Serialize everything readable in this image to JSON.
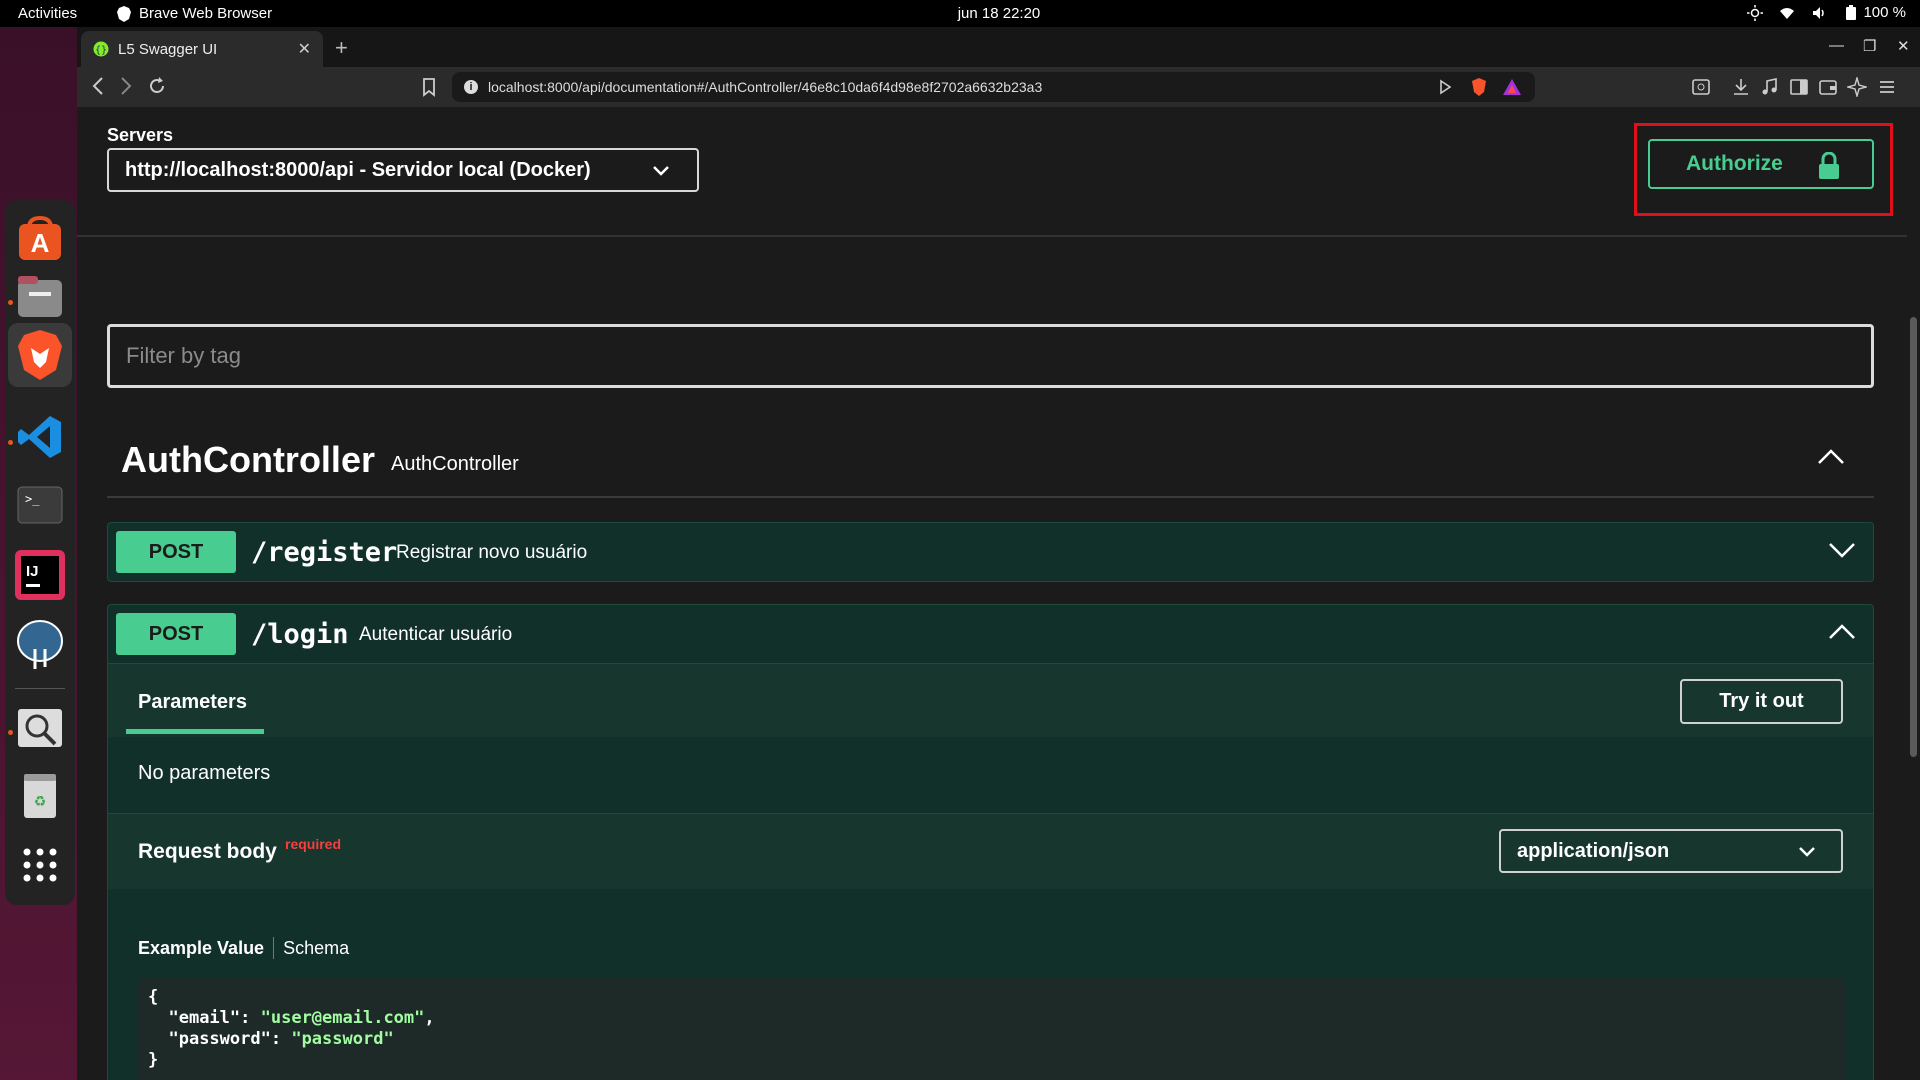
{
  "system": {
    "activities": "Activities",
    "app_name": "Brave Web Browser",
    "clock": "jun 18  22:20",
    "battery": "100 %"
  },
  "browser": {
    "tab_title": "L5 Swagger UI",
    "new_tab": "+",
    "url": "localhost:8000/api/documentation#/AuthController/46e8c10da6f4d98e8f2702a6632b23a3"
  },
  "swagger": {
    "servers_label": "Servers",
    "server_selected": "http://localhost:8000/api - Servidor local (Docker)",
    "authorize_label": "Authorize",
    "filter_placeholder": "Filter by tag",
    "tag": {
      "name": "AuthController",
      "description": "AuthController"
    },
    "operations": [
      {
        "method": "POST",
        "path": "/register",
        "summary": "Registrar novo usuário",
        "expanded": false
      },
      {
        "method": "POST",
        "path": "/login",
        "summary": "Autenticar usuário",
        "expanded": true
      }
    ],
    "login_detail": {
      "parameters_tab": "Parameters",
      "try_it_out": "Try it out",
      "no_parameters": "No parameters",
      "request_body": "Request body",
      "required": "required",
      "content_type": "application/json",
      "example_value_tab": "Example Value",
      "schema_tab": "Schema",
      "example": {
        "open": "{",
        "email_key": "\"email\"",
        "email_value": "\"user@email.com\"",
        "password_key": "\"password\"",
        "password_value": "\"password\"",
        "close": "}"
      }
    }
  },
  "colors": {
    "post_green": "#49cc90",
    "highlight_red": "#e0101b",
    "required_red": "#f93e3e",
    "ubuntu_orange": "#e95420"
  },
  "icons": [
    "shield-brave-icon",
    "wifi-icon",
    "volume-icon",
    "battery-icon",
    "brightness-icon",
    "chevron-down-icon",
    "chevron-up-icon",
    "lock-icon",
    "back-icon",
    "forward-icon",
    "reload-icon",
    "bookmark-icon",
    "info-icon"
  ]
}
